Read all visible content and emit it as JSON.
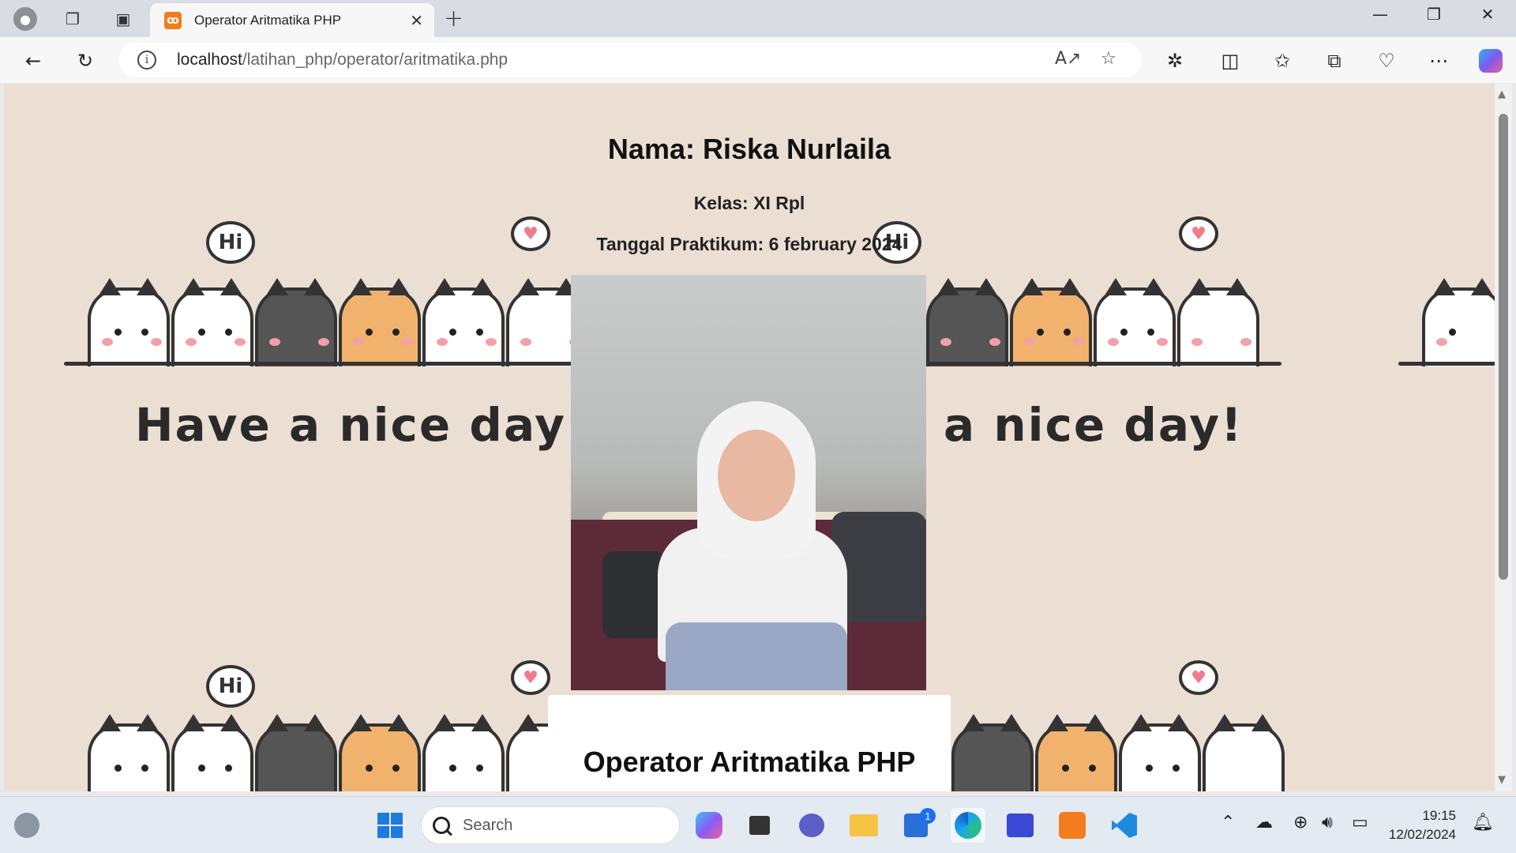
{
  "browser": {
    "tab_title": "Operator Aritmatika PHP",
    "url_host": "localhost",
    "url_path": "/latihan_php/operator/aritmatika.php",
    "favicon_glyph": "ꝏ"
  },
  "page": {
    "name_line": "Nama: Riska Nurlaila",
    "kelas_line": "Kelas: XI Rpl",
    "tanggal_line": "Tanggal Praktikum: 6 february 2024",
    "card_title": "Operator Aritmatika PHP",
    "background_slogan": "Have a nice day!",
    "background_slogan_right": "a nice day!",
    "bubble_text": "Hi"
  },
  "taskbar": {
    "search_placeholder": "Search",
    "time": "19:15",
    "date": "12/02/2024",
    "store_badge": "1"
  },
  "colors": {
    "page_bg": "#ebdfd4",
    "accent": "#f37c1f"
  }
}
